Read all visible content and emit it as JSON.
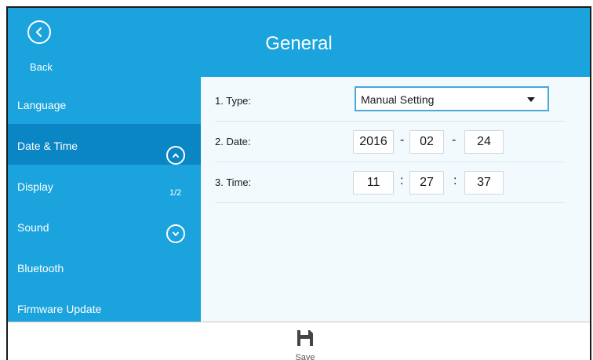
{
  "header": {
    "title": "General",
    "back_label": "Back"
  },
  "sidebar": {
    "items": [
      {
        "label": "Language"
      },
      {
        "label": "Date & Time"
      },
      {
        "label": "Display"
      },
      {
        "label": "Sound"
      },
      {
        "label": "Bluetooth"
      },
      {
        "label": "Firmware Update"
      }
    ],
    "active_item": "Date & Time",
    "page_indicator": "1/2"
  },
  "form": {
    "type": {
      "label": "1. Type:",
      "value": "Manual Setting"
    },
    "date": {
      "label": "2. Date:",
      "year": "2016",
      "month": "02",
      "day": "24",
      "separator": "-"
    },
    "time": {
      "label": "3. Time:",
      "hour": "11",
      "minute": "27",
      "second": "37",
      "separator": ":"
    }
  },
  "footer": {
    "save_label": "Save"
  },
  "colors": {
    "header_blue": "#1aa3dc",
    "active_blue": "#0a86c4",
    "content_bg": "#f2fafd"
  },
  "icons": {
    "back": "chevron-left-circle-icon",
    "scroll_up": "chevron-up-circle-icon",
    "scroll_down": "chevron-down-circle-icon",
    "save": "floppy-disk-icon"
  }
}
